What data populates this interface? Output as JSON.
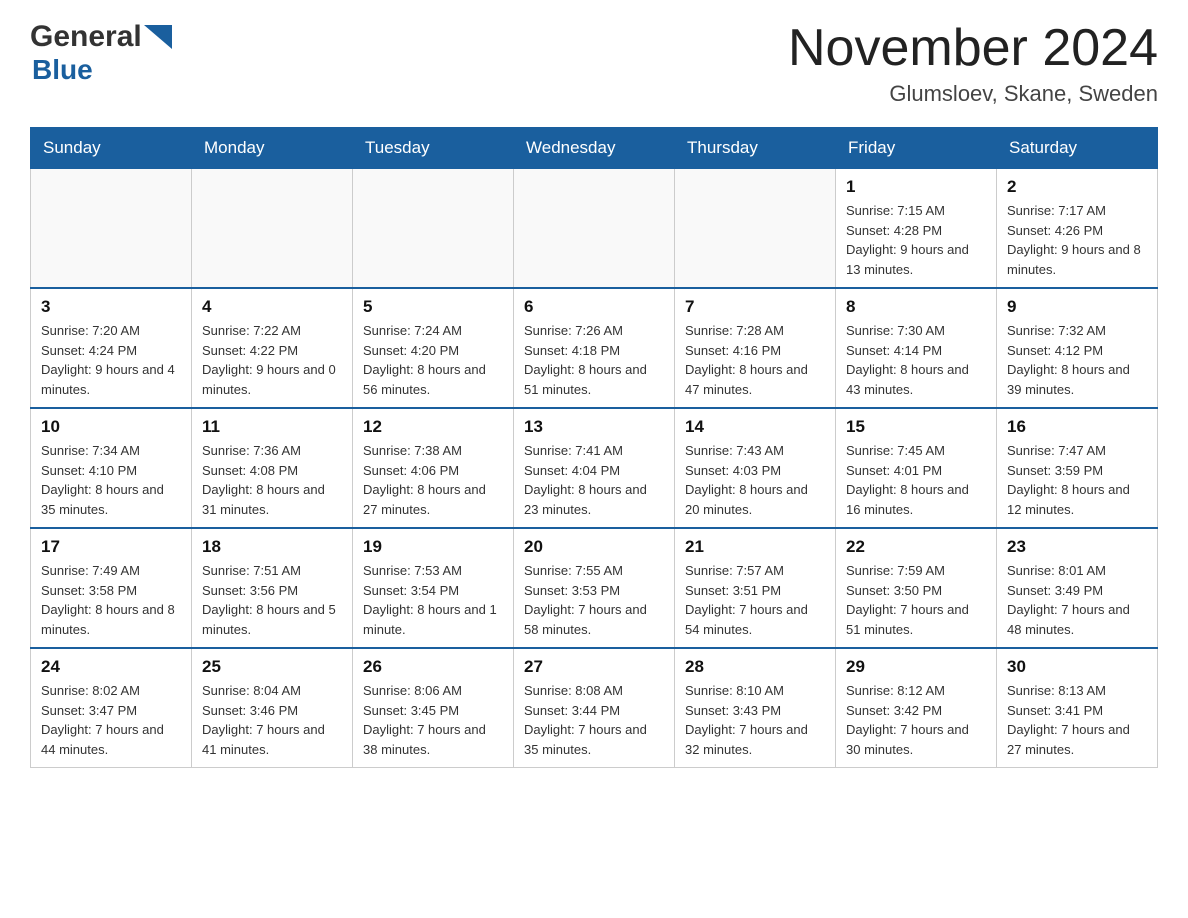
{
  "header": {
    "logo_general": "General",
    "logo_blue": "Blue",
    "month_title": "November 2024",
    "location": "Glumsloev, Skane, Sweden"
  },
  "days_of_week": [
    "Sunday",
    "Monday",
    "Tuesday",
    "Wednesday",
    "Thursday",
    "Friday",
    "Saturday"
  ],
  "weeks": [
    [
      {
        "day": "",
        "info": ""
      },
      {
        "day": "",
        "info": ""
      },
      {
        "day": "",
        "info": ""
      },
      {
        "day": "",
        "info": ""
      },
      {
        "day": "",
        "info": ""
      },
      {
        "day": "1",
        "info": "Sunrise: 7:15 AM\nSunset: 4:28 PM\nDaylight: 9 hours and 13 minutes."
      },
      {
        "day": "2",
        "info": "Sunrise: 7:17 AM\nSunset: 4:26 PM\nDaylight: 9 hours and 8 minutes."
      }
    ],
    [
      {
        "day": "3",
        "info": "Sunrise: 7:20 AM\nSunset: 4:24 PM\nDaylight: 9 hours and 4 minutes."
      },
      {
        "day": "4",
        "info": "Sunrise: 7:22 AM\nSunset: 4:22 PM\nDaylight: 9 hours and 0 minutes."
      },
      {
        "day": "5",
        "info": "Sunrise: 7:24 AM\nSunset: 4:20 PM\nDaylight: 8 hours and 56 minutes."
      },
      {
        "day": "6",
        "info": "Sunrise: 7:26 AM\nSunset: 4:18 PM\nDaylight: 8 hours and 51 minutes."
      },
      {
        "day": "7",
        "info": "Sunrise: 7:28 AM\nSunset: 4:16 PM\nDaylight: 8 hours and 47 minutes."
      },
      {
        "day": "8",
        "info": "Sunrise: 7:30 AM\nSunset: 4:14 PM\nDaylight: 8 hours and 43 minutes."
      },
      {
        "day": "9",
        "info": "Sunrise: 7:32 AM\nSunset: 4:12 PM\nDaylight: 8 hours and 39 minutes."
      }
    ],
    [
      {
        "day": "10",
        "info": "Sunrise: 7:34 AM\nSunset: 4:10 PM\nDaylight: 8 hours and 35 minutes."
      },
      {
        "day": "11",
        "info": "Sunrise: 7:36 AM\nSunset: 4:08 PM\nDaylight: 8 hours and 31 minutes."
      },
      {
        "day": "12",
        "info": "Sunrise: 7:38 AM\nSunset: 4:06 PM\nDaylight: 8 hours and 27 minutes."
      },
      {
        "day": "13",
        "info": "Sunrise: 7:41 AM\nSunset: 4:04 PM\nDaylight: 8 hours and 23 minutes."
      },
      {
        "day": "14",
        "info": "Sunrise: 7:43 AM\nSunset: 4:03 PM\nDaylight: 8 hours and 20 minutes."
      },
      {
        "day": "15",
        "info": "Sunrise: 7:45 AM\nSunset: 4:01 PM\nDaylight: 8 hours and 16 minutes."
      },
      {
        "day": "16",
        "info": "Sunrise: 7:47 AM\nSunset: 3:59 PM\nDaylight: 8 hours and 12 minutes."
      }
    ],
    [
      {
        "day": "17",
        "info": "Sunrise: 7:49 AM\nSunset: 3:58 PM\nDaylight: 8 hours and 8 minutes."
      },
      {
        "day": "18",
        "info": "Sunrise: 7:51 AM\nSunset: 3:56 PM\nDaylight: 8 hours and 5 minutes."
      },
      {
        "day": "19",
        "info": "Sunrise: 7:53 AM\nSunset: 3:54 PM\nDaylight: 8 hours and 1 minute."
      },
      {
        "day": "20",
        "info": "Sunrise: 7:55 AM\nSunset: 3:53 PM\nDaylight: 7 hours and 58 minutes."
      },
      {
        "day": "21",
        "info": "Sunrise: 7:57 AM\nSunset: 3:51 PM\nDaylight: 7 hours and 54 minutes."
      },
      {
        "day": "22",
        "info": "Sunrise: 7:59 AM\nSunset: 3:50 PM\nDaylight: 7 hours and 51 minutes."
      },
      {
        "day": "23",
        "info": "Sunrise: 8:01 AM\nSunset: 3:49 PM\nDaylight: 7 hours and 48 minutes."
      }
    ],
    [
      {
        "day": "24",
        "info": "Sunrise: 8:02 AM\nSunset: 3:47 PM\nDaylight: 7 hours and 44 minutes."
      },
      {
        "day": "25",
        "info": "Sunrise: 8:04 AM\nSunset: 3:46 PM\nDaylight: 7 hours and 41 minutes."
      },
      {
        "day": "26",
        "info": "Sunrise: 8:06 AM\nSunset: 3:45 PM\nDaylight: 7 hours and 38 minutes."
      },
      {
        "day": "27",
        "info": "Sunrise: 8:08 AM\nSunset: 3:44 PM\nDaylight: 7 hours and 35 minutes."
      },
      {
        "day": "28",
        "info": "Sunrise: 8:10 AM\nSunset: 3:43 PM\nDaylight: 7 hours and 32 minutes."
      },
      {
        "day": "29",
        "info": "Sunrise: 8:12 AM\nSunset: 3:42 PM\nDaylight: 7 hours and 30 minutes."
      },
      {
        "day": "30",
        "info": "Sunrise: 8:13 AM\nSunset: 3:41 PM\nDaylight: 7 hours and 27 minutes."
      }
    ]
  ]
}
